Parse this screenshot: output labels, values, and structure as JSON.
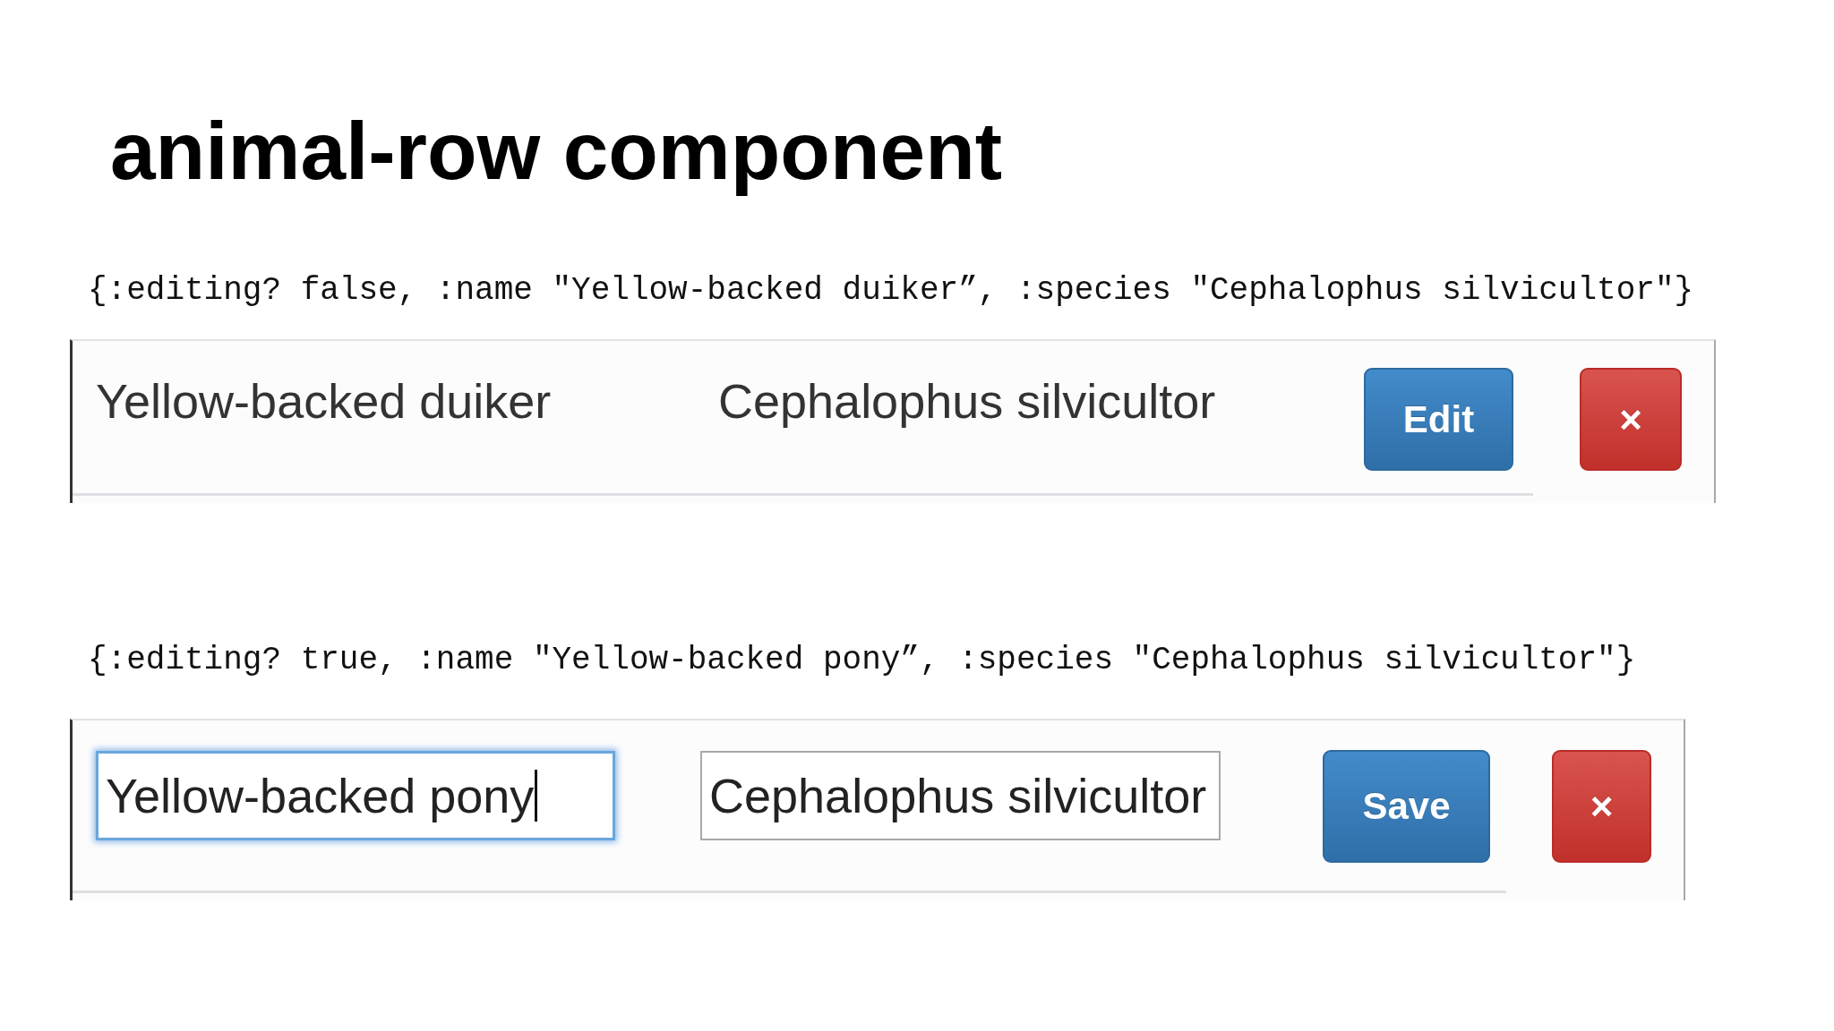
{
  "title": "animal-row component",
  "examples": [
    {
      "code": "{:editing? false, :name \"Yellow-backed duiker”, :species \"Cephalophus silvicultor\"}",
      "row": {
        "editing": false,
        "cells": [
          {
            "value": "Yellow-backed duiker"
          },
          {
            "value": "Cephalophus silvicultor"
          }
        ],
        "buttons": [
          {
            "kind": "primary",
            "label": "Edit"
          },
          {
            "kind": "danger",
            "label": "×"
          }
        ]
      }
    },
    {
      "code": "{:editing? true, :name \"Yellow-backed pony”, :species \"Cephalophus silvicultor\"}",
      "row": {
        "editing": true,
        "cells": [
          {
            "value": "Yellow-backed pony",
            "focused": true
          },
          {
            "value": "Cephalophus silvicultor",
            "focused": false
          }
        ],
        "buttons": [
          {
            "kind": "primary",
            "label": "Save"
          },
          {
            "kind": "danger",
            "label": "×"
          }
        ]
      }
    }
  ]
}
